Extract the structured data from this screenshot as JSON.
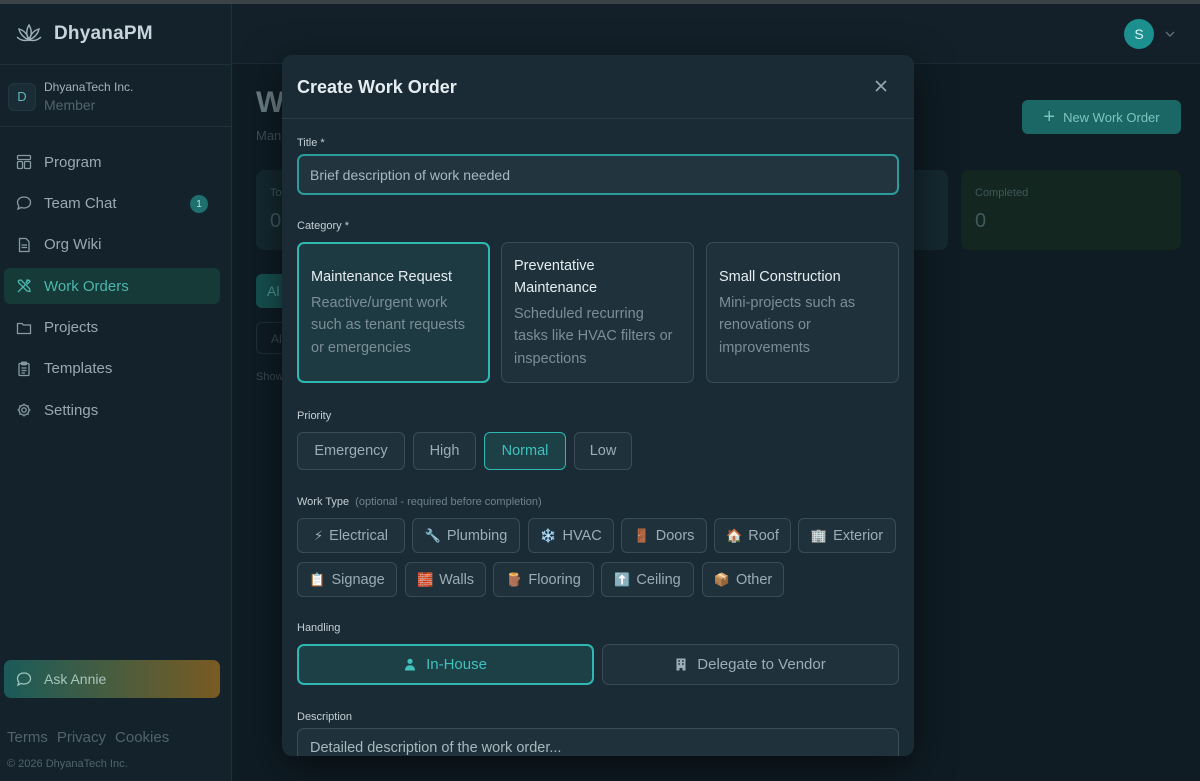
{
  "brand": {
    "name": "DhyanaPM"
  },
  "org": {
    "initial": "D",
    "name": "DhyanaTech Inc.",
    "role": "Member"
  },
  "sidebar": {
    "items": [
      {
        "label": "Program"
      },
      {
        "label": "Team Chat",
        "badge": "1"
      },
      {
        "label": "Org Wiki"
      },
      {
        "label": "Work Orders",
        "active": true
      },
      {
        "label": "Projects"
      },
      {
        "label": "Templates"
      },
      {
        "label": "Settings"
      }
    ],
    "ask_label": "Ask Annie",
    "footer_links": [
      "Terms",
      "Privacy",
      "Cookies"
    ],
    "copyright": "© 2026 DhyanaTech Inc."
  },
  "header": {
    "avatar_initial": "S"
  },
  "background": {
    "title_partial": "W",
    "subtitle_partial": "Man",
    "new_button": "New Work Order",
    "stats": [
      {
        "label_partial": "To",
        "value": "0"
      },
      {
        "label": "Completed",
        "value": "0"
      }
    ],
    "tab_partial": "Al",
    "filter_partial": "Al",
    "showing_partial": "Show"
  },
  "modal": {
    "title": "Create Work Order",
    "title_label": "Title *",
    "title_placeholder": "Brief description of work needed",
    "category_label": "Category *",
    "categories": [
      {
        "name": "Maintenance Request",
        "desc": "Reactive/urgent work such as tenant requests or emergencies",
        "selected": true
      },
      {
        "name": "Preventative Maintenance",
        "desc": "Scheduled recurring tasks like HVAC filters or inspections"
      },
      {
        "name": "Small Construction",
        "desc": "Mini-projects such as renovations or improvements"
      }
    ],
    "priority_label": "Priority",
    "priorities": [
      "Emergency",
      "High",
      "Normal",
      "Low"
    ],
    "priority_selected": "Normal",
    "work_type_label": "Work Type",
    "work_type_note": "(optional - required before completion)",
    "work_types": [
      {
        "icon": "⚡",
        "label": "Electrical"
      },
      {
        "icon": "🔧",
        "label": "Plumbing"
      },
      {
        "icon": "❄️",
        "label": "HVAC"
      },
      {
        "icon": "🚪",
        "label": "Doors"
      },
      {
        "icon": "🏠",
        "label": "Roof"
      },
      {
        "icon": "🏢",
        "label": "Exterior"
      },
      {
        "icon": "📋",
        "label": "Signage"
      },
      {
        "icon": "🧱",
        "label": "Walls"
      },
      {
        "icon": "🪵",
        "label": "Flooring"
      },
      {
        "icon": "⬆️",
        "label": "Ceiling"
      },
      {
        "icon": "📦",
        "label": "Other"
      }
    ],
    "handling_label": "Handling",
    "handling_options": [
      "In-House",
      "Delegate to Vendor"
    ],
    "handling_selected": "In-House",
    "description_label": "Description",
    "description_placeholder": "Detailed description of the work order..."
  },
  "colors": {
    "accent": "#2fb7b2",
    "modal_bg": "#1b2b35",
    "sidebar_bg": "#13222b"
  }
}
